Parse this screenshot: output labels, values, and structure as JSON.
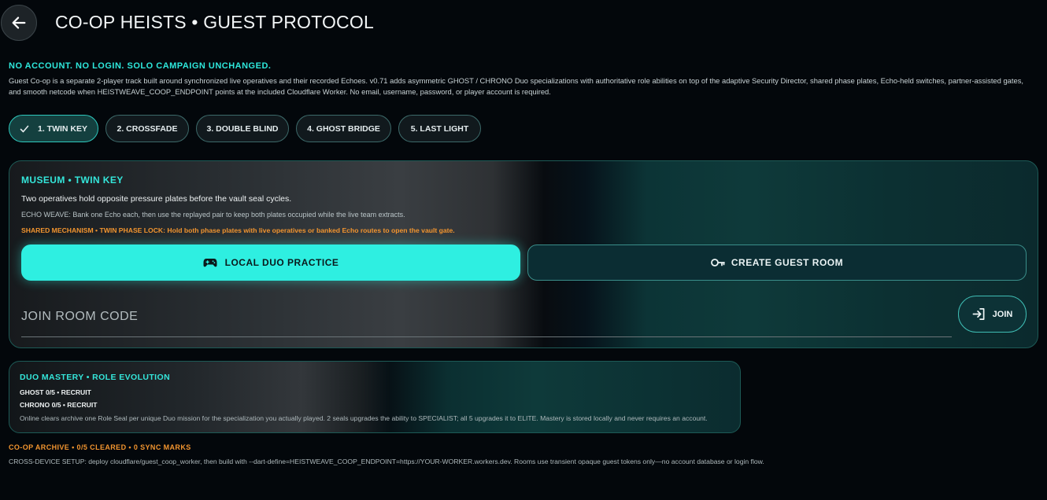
{
  "header": {
    "title": "CO-OP HEISTS • GUEST PROTOCOL",
    "back_icon": "arrow-left-icon"
  },
  "notice": "NO ACCOUNT. NO LOGIN. SOLO CAMPAIGN UNCHANGED.",
  "intro": "Guest Co-op is a separate 2-player track built around synchronized live operatives and their recorded Echoes. v0.71 adds asymmetric GHOST / CHRONO Duo specializations with authoritative role abilities on top of the adaptive Security Director, shared phase plates, Echo-held switches, partner-assisted gates, and smooth netcode when HEISTWEAVE_COOP_ENDPOINT points at the included Cloudflare Worker. No email, username, password, or player account is required.",
  "missions": [
    {
      "label": "1. TWIN KEY",
      "selected": true,
      "icon": "check-icon"
    },
    {
      "label": "2. CROSSFADE",
      "selected": false
    },
    {
      "label": "3. DOUBLE BLIND",
      "selected": false
    },
    {
      "label": "4. GHOST BRIDGE",
      "selected": false
    },
    {
      "label": "5. LAST LIGHT",
      "selected": false
    }
  ],
  "mission": {
    "heading": "MUSEUM • TWIN KEY",
    "description": "Two operatives hold opposite pressure plates before the vault seal cycles.",
    "echo": "ECHO WEAVE: Bank one Echo each, then use the replayed pair to keep both plates occupied while the live team extracts.",
    "mechanism": "SHARED MECHANISM • TWIN PHASE LOCK: Hold both phase plates with live operatives or banked Echo routes to open the vault gate.",
    "local_button": {
      "label": "LOCAL DUO PRACTICE",
      "icon": "gamepad-icon"
    },
    "create_button": {
      "label": "CREATE GUEST ROOM",
      "icon": "key-icon"
    },
    "join_field": {
      "placeholder": "JOIN ROOM CODE",
      "value": ""
    },
    "join_button": {
      "label": "JOIN",
      "icon": "login-icon"
    }
  },
  "mastery": {
    "heading": "DUO MASTERY • ROLE EVOLUTION",
    "ghost": "GHOST  0/5 • RECRUIT",
    "chrono": "CHRONO  0/5 • RECRUIT",
    "note": "Online clears archive one Role Seal per unique Duo mission for the specialization you actually played. 2 seals upgrades the ability to SPECIALIST; all 5 upgrades it to ELITE. Mastery is stored locally and never requires an account."
  },
  "archive": "CO-OP ARCHIVE • 0/5 CLEARED • 0 SYNC MARKS",
  "setup": "CROSS-DEVICE SETUP: deploy cloudflare/guest_coop_worker, then build with --dart-define=HEISTWEAVE_COOP_ENDPOINT=https://YOUR-WORKER.workers.dev. Rooms use transient opaque guest tokens only—no account database or login flow.",
  "colors": {
    "accent": "#2eefe1",
    "warning": "#f2952f",
    "background": "#03070b"
  }
}
